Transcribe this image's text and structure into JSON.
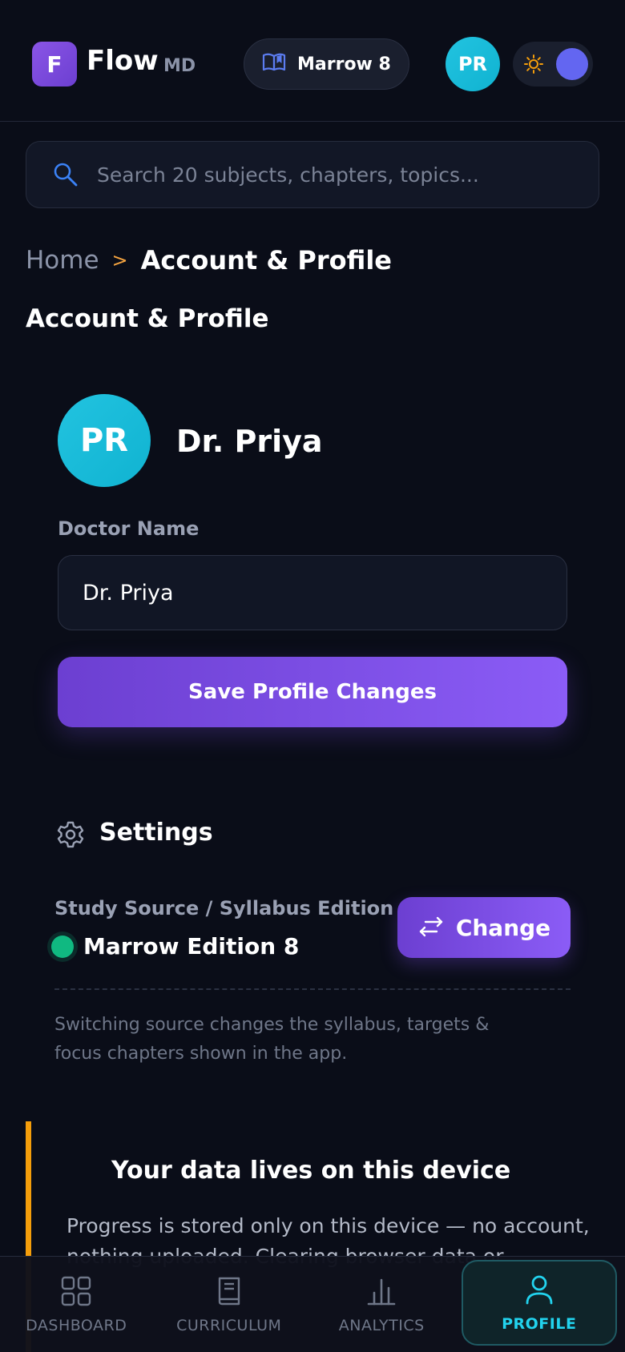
{
  "app": {
    "logo_letter": "F",
    "name": "Flow",
    "suffix": "MD"
  },
  "header": {
    "source_pill_label": "Marrow 8",
    "user_initials": "PR"
  },
  "search": {
    "placeholder": "Search 20 subjects, chapters, topics..."
  },
  "breadcrumb": {
    "home": "Home",
    "separator": ">",
    "current": "Account & Profile"
  },
  "page": {
    "title": "Account & Profile"
  },
  "profile": {
    "initials": "PR",
    "display_name": "Dr. Priya",
    "field_label": "Doctor Name",
    "field_value": "Dr. Priya",
    "save_label": "Save Profile Changes"
  },
  "settings": {
    "title": "Settings",
    "source_label": "Study Source / Syllabus Edition",
    "source_value": "Marrow Edition 8",
    "change_label": "Change",
    "note": "Switching source changes the syllabus, targets & focus chapters shown in the app."
  },
  "data_notice": {
    "title": "Your data lives on this device",
    "text": "Progress is stored only on this device — no account, nothing uploaded. Clearing browser data or"
  },
  "nav": {
    "items": [
      {
        "label": "DASHBOARD",
        "icon": "grid-icon"
      },
      {
        "label": "CURRICULUM",
        "icon": "book-icon"
      },
      {
        "label": "ANALYTICS",
        "icon": "bar-chart-icon"
      },
      {
        "label": "PROFILE",
        "icon": "user-icon",
        "active": true
      }
    ]
  },
  "colors": {
    "background": "#0a0d18",
    "accent_purple": "#8b5cf6",
    "accent_cyan": "#22d3ee",
    "warning": "#f59e0b",
    "success": "#10b981"
  }
}
